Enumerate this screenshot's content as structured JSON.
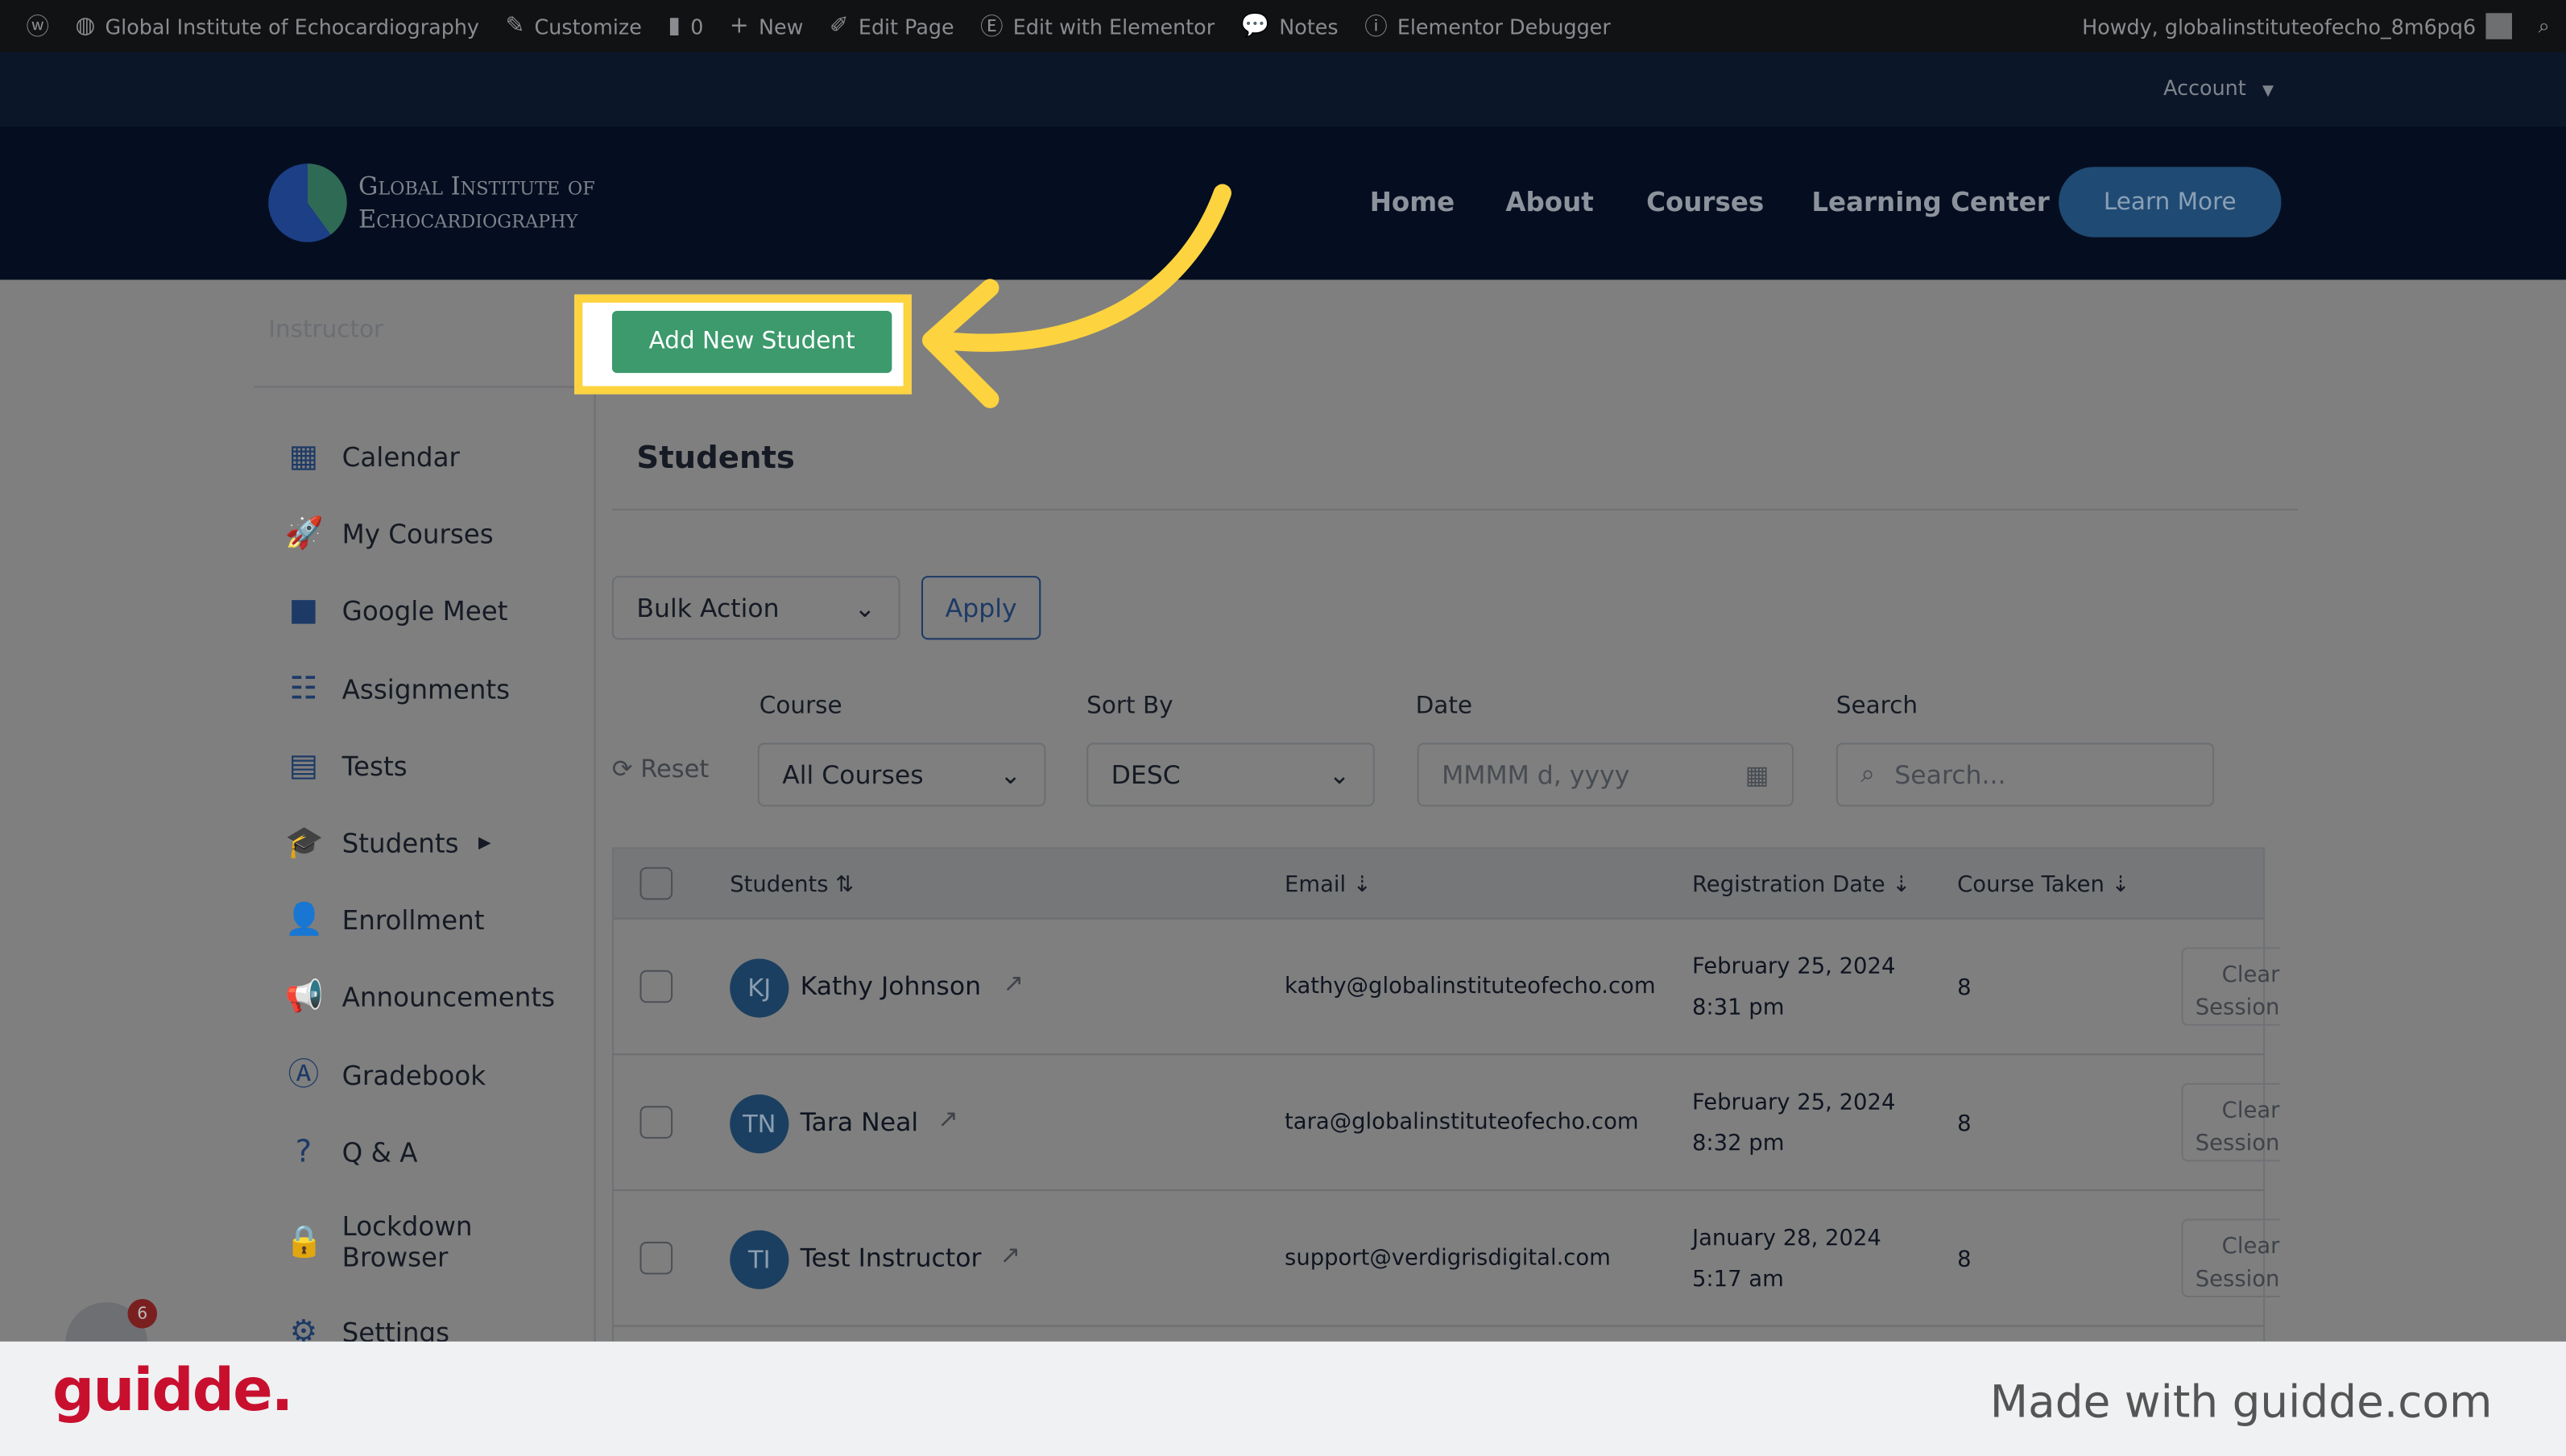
{
  "admin_bar": {
    "site": "Global Institute of Echocardiography",
    "customize": "Customize",
    "comments": "0",
    "new": "New",
    "edit_page": "Edit Page",
    "edit_elementor": "Edit with Elementor",
    "notes": "Notes",
    "debugger": "Elementor Debugger",
    "howdy": "Howdy, globalinstituteofecho_8m6pq6"
  },
  "account": {
    "label": "Account"
  },
  "header": {
    "logo_line1": "Global Institute of",
    "logo_line2": "Echocardiography",
    "nav": [
      "Home",
      "About",
      "Courses",
      "Learning Center"
    ],
    "cta": "Learn More"
  },
  "sidebar": {
    "role": "Instructor",
    "items": [
      {
        "label": "Calendar",
        "icon": "calendar-icon"
      },
      {
        "label": "My Courses",
        "icon": "rocket-icon"
      },
      {
        "label": "Google Meet",
        "icon": "video-icon"
      },
      {
        "label": "Assignments",
        "icon": "assignment-icon"
      },
      {
        "label": "Tests",
        "icon": "quiz-icon"
      },
      {
        "label": "Students",
        "icon": "graduation-cap-icon"
      },
      {
        "label": "Enrollment",
        "icon": "user-icon"
      },
      {
        "label": "Announcements",
        "icon": "megaphone-icon"
      },
      {
        "label": "Gradebook",
        "icon": "gradebook-icon"
      },
      {
        "label": "Q & A",
        "icon": "question-icon"
      },
      {
        "label": "Lockdown Browser",
        "icon": "lock-icon"
      },
      {
        "label": "Settings",
        "icon": "gear-icon"
      }
    ],
    "notification_count": "6"
  },
  "main": {
    "add_button": "Add New Student",
    "title": "Students",
    "bulk_action": "Bulk Action",
    "apply": "Apply",
    "reset": "Reset",
    "filters": {
      "course_label": "Course",
      "course_value": "All Courses",
      "sort_label": "Sort By",
      "sort_value": "DESC",
      "date_label": "Date",
      "date_placeholder": "MMMM d, yyyy",
      "search_label": "Search",
      "search_placeholder": "Search..."
    },
    "table": {
      "headers": [
        "Students",
        "Email",
        "Registration Date",
        "Course Taken"
      ],
      "rows": [
        {
          "initials": "KJ",
          "name": "Kathy Johnson",
          "email": "kathy@globalinstituteofecho.com",
          "date": "February 25, 2024",
          "time": "8:31 pm",
          "courses": "8",
          "action": "Clear Session"
        },
        {
          "initials": "TN",
          "name": "Tara Neal",
          "email": "tara@globalinstituteofecho.com",
          "date": "February 25, 2024",
          "time": "8:32 pm",
          "courses": "8",
          "action": "Clear Session"
        },
        {
          "initials": "TI",
          "name": "Test Instructor",
          "email": "support@verdigrisdigital.com",
          "date": "January 28, 2024",
          "time": "5:17 am",
          "courses": "8",
          "action": "Clear Session"
        }
      ]
    }
  },
  "footer": {
    "brand": "guidde.",
    "tagline": "Made with guidde.com"
  },
  "colors": {
    "highlight": "#fdd33f",
    "button_green": "#3c9a6c",
    "brand_red": "#c8102e"
  }
}
